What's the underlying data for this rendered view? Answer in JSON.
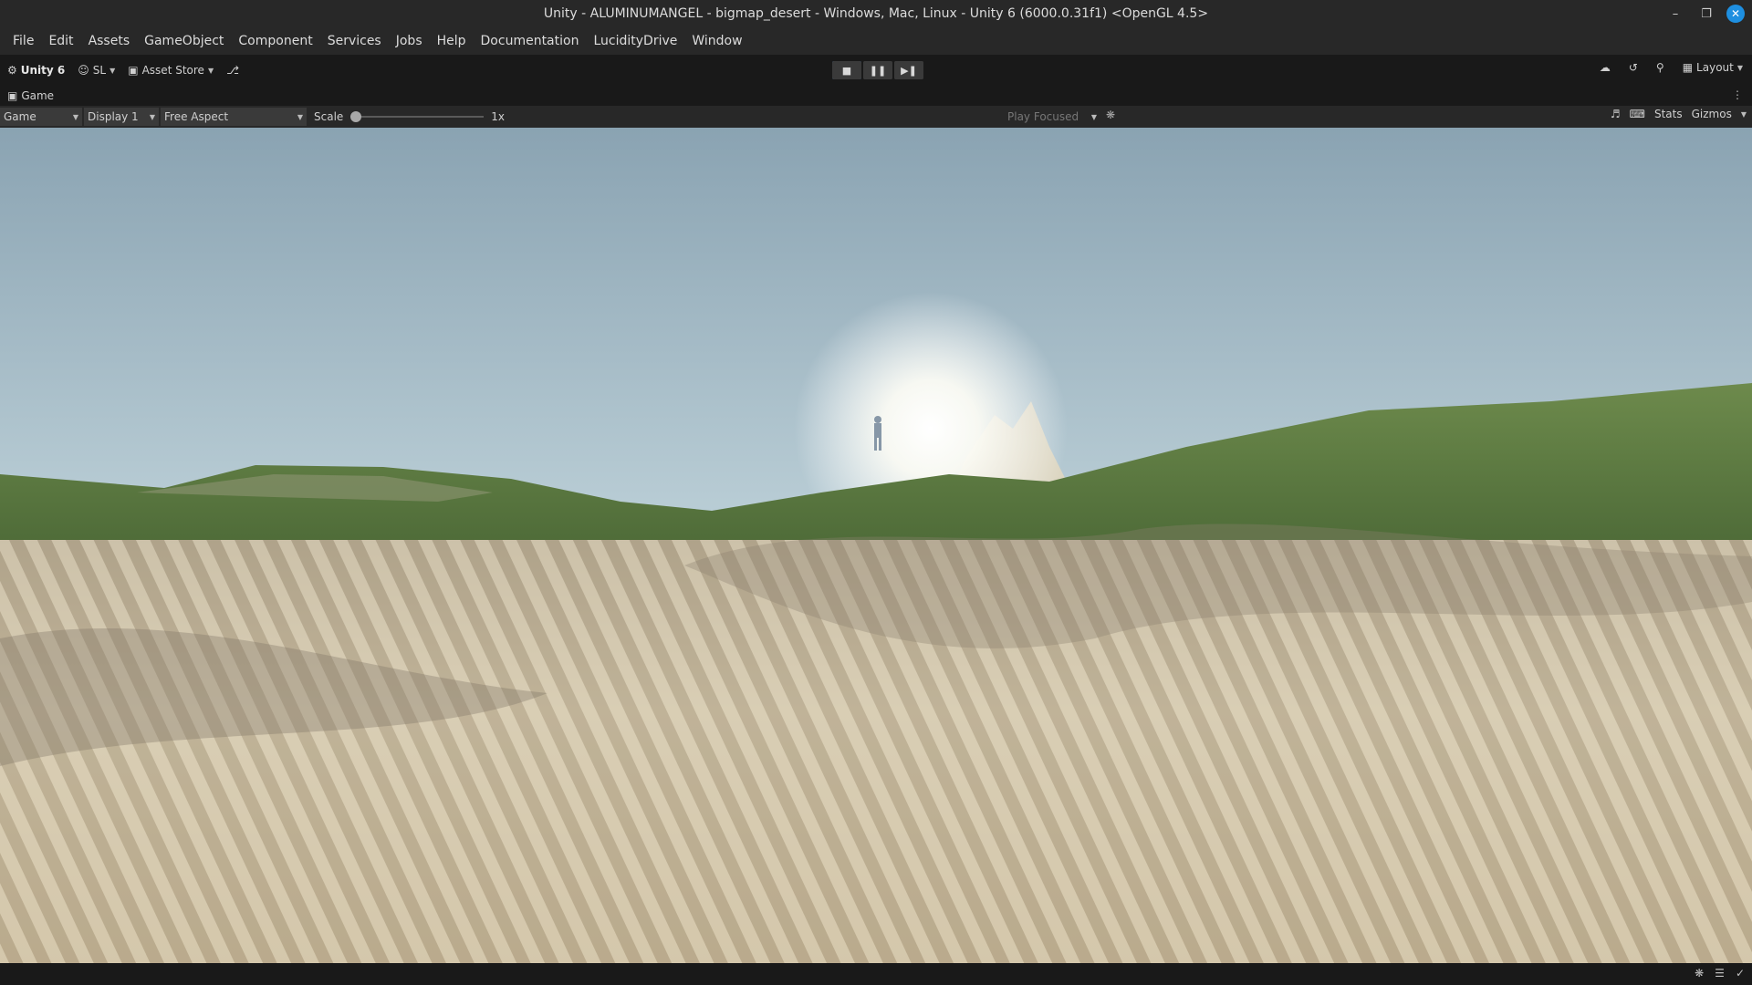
{
  "window": {
    "title": "Unity - ALUMINUMANGEL - bigmap_desert - Windows, Mac, Linux - Unity 6 (6000.0.31f1) <OpenGL 4.5>",
    "controls": [
      "minimize-icon",
      "restore-icon",
      "close-icon"
    ]
  },
  "menu": [
    "File",
    "Edit",
    "Assets",
    "GameObject",
    "Component",
    "Services",
    "Jobs",
    "Help",
    "Documentation",
    "LucidityDrive",
    "Window"
  ],
  "toolbar": {
    "unity_label": "Unity 6",
    "account_label": "SL",
    "asset_store_label": "Asset Store",
    "layout_label": "Layout"
  },
  "tab": {
    "label": "Game"
  },
  "gamebar": {
    "view_mode": "Game",
    "display": "Display 1",
    "aspect": "Free Aspect",
    "scale_label": "Scale",
    "scale_value": "1x",
    "play_mode": "Play Focused",
    "stats_label": "Stats",
    "gizmos_label": "Gizmos"
  },
  "colors": {
    "accent": "#3c6fb0",
    "close": "#1e8fe0",
    "sky_top": "#8aa3b2",
    "sky_horizon": "#e4ecec",
    "grass": "#5a7a3e",
    "sand": "#cbbd9f"
  }
}
